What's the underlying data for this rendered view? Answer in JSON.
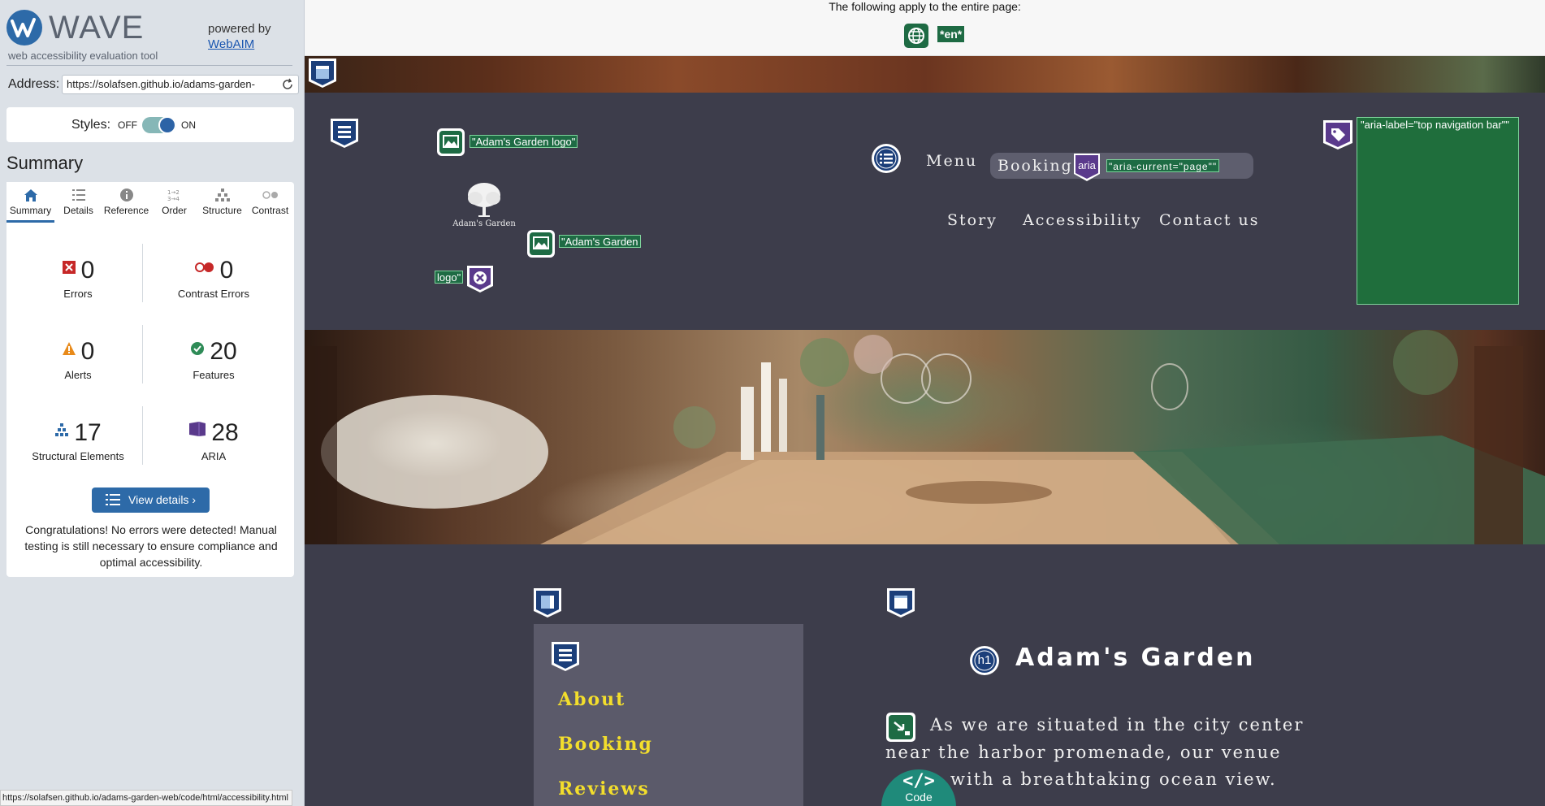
{
  "wave": {
    "brand": "WAVE",
    "tagline": "web accessibility evaluation tool",
    "powered_by": "powered by",
    "webaim_link": "WebAIM",
    "address_label": "Address:",
    "address_value": "https://solafsen.github.io/adams-garden-",
    "styles_label": "Styles:",
    "styles_off": "OFF",
    "styles_on": "ON",
    "styles_state": "on",
    "summary_title": "Summary",
    "tabs": [
      {
        "label": "Summary",
        "icon": "home-icon",
        "active": true
      },
      {
        "label": "Details",
        "icon": "list-icon"
      },
      {
        "label": "Reference",
        "icon": "info-icon"
      },
      {
        "label": "Order",
        "icon": "order-icon"
      },
      {
        "label": "Structure",
        "icon": "structure-icon"
      },
      {
        "label": "Contrast",
        "icon": "contrast-icon"
      }
    ],
    "stats": {
      "errors": {
        "value": "0",
        "label": "Errors"
      },
      "contrast_errors": {
        "value": "0",
        "label": "Contrast Errors"
      },
      "alerts": {
        "value": "0",
        "label": "Alerts"
      },
      "features": {
        "value": "20",
        "label": "Features"
      },
      "structural": {
        "value": "17",
        "label": "Structural Elements"
      },
      "aria": {
        "value": "28",
        "label": "ARIA"
      }
    },
    "view_details": "View details ›",
    "congrats": "Congratulations! No errors were detected! Manual testing is still necessary to ensure compliance and optimal accessibility.",
    "status_url": "https://solafsen.github.io/adams-garden-web/code/html/accessibility.html"
  },
  "page": {
    "applies_text": "The following apply to the entire page:",
    "lang_tag": "*en*",
    "logo_tip_1": "\"Adam's Garden logo\"",
    "logo_tip_2a": "\"Adam's Garden",
    "logo_tip_2b": "logo\"",
    "logo_name": "Adam's Garden",
    "nav": {
      "menu": "Menu",
      "booking": "Booking",
      "aria_badge": "aria",
      "aria_current": "\"aria-current=\"page\"\"",
      "story": "Story",
      "accessibility": "Accessibility",
      "contact": "Contact us"
    },
    "nav_aria_label": "\"aria-label=\"top navigation bar\"\"",
    "side_menu": [
      "About",
      "Booking",
      "Reviews"
    ],
    "h1_badge": "h1",
    "title": "Adam's Garden",
    "paragraph_lines": [
      "As we are situated in the city center",
      "near the harbor promenade, our venue",
      "with a breathtaking ocean view."
    ],
    "code_glyph": "</>",
    "code_label": "Code"
  },
  "colors": {
    "wave_blue": "#2d6aa8",
    "feature_green": "#1e6b44",
    "aria_purple": "#5a3a8c",
    "page_bg": "#3d3d4b",
    "link_yellow": "#f3de2c",
    "error_red": "#c62828"
  }
}
